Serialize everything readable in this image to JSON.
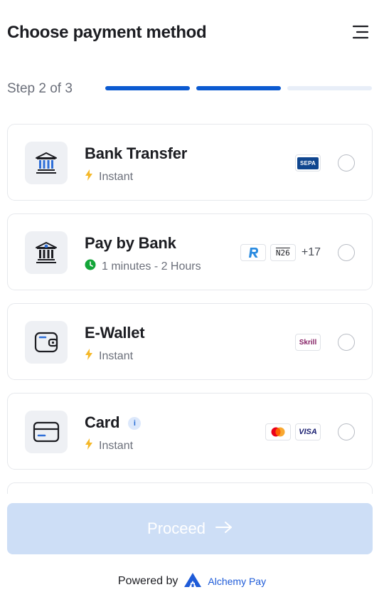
{
  "header": {
    "title": "Choose payment method",
    "menu_icon": "menu-icon"
  },
  "progress": {
    "label": "Step 2 of 3",
    "current_step": 2,
    "total_steps": 3,
    "active_color": "#0b5ad1",
    "inactive_color": "#e8eef8"
  },
  "methods": [
    {
      "name": "Bank Transfer",
      "speed": "Instant",
      "icon": "bank-icon",
      "badges": [
        "SEPA"
      ],
      "extra": "",
      "selected": false
    },
    {
      "name": "Pay by Bank",
      "speed": "1 minutes - 2 Hours",
      "icon": "bank-euro-icon",
      "badges": [
        "Revolut",
        "N26"
      ],
      "extra": "+17",
      "selected": false
    },
    {
      "name": "E-Wallet",
      "speed": "Instant",
      "icon": "wallet-icon",
      "badges": [
        "Skrill"
      ],
      "extra": "",
      "selected": false
    },
    {
      "name": "Card",
      "speed": "Instant",
      "icon": "card-icon",
      "badges": [
        "Mastercard",
        "VISA"
      ],
      "extra": "",
      "selected": false
    }
  ],
  "badge_text": {
    "sepa": "SEPA",
    "n26": "N26",
    "skrill": "Skrill",
    "visa": "VISA",
    "info": "i"
  },
  "proceed": {
    "label": "Proceed",
    "enabled": false,
    "color": "#cddef6"
  },
  "footer": {
    "powered_by": "Powered by",
    "brand": "Alchemy Pay",
    "brand_color": "#1e5bd8"
  }
}
